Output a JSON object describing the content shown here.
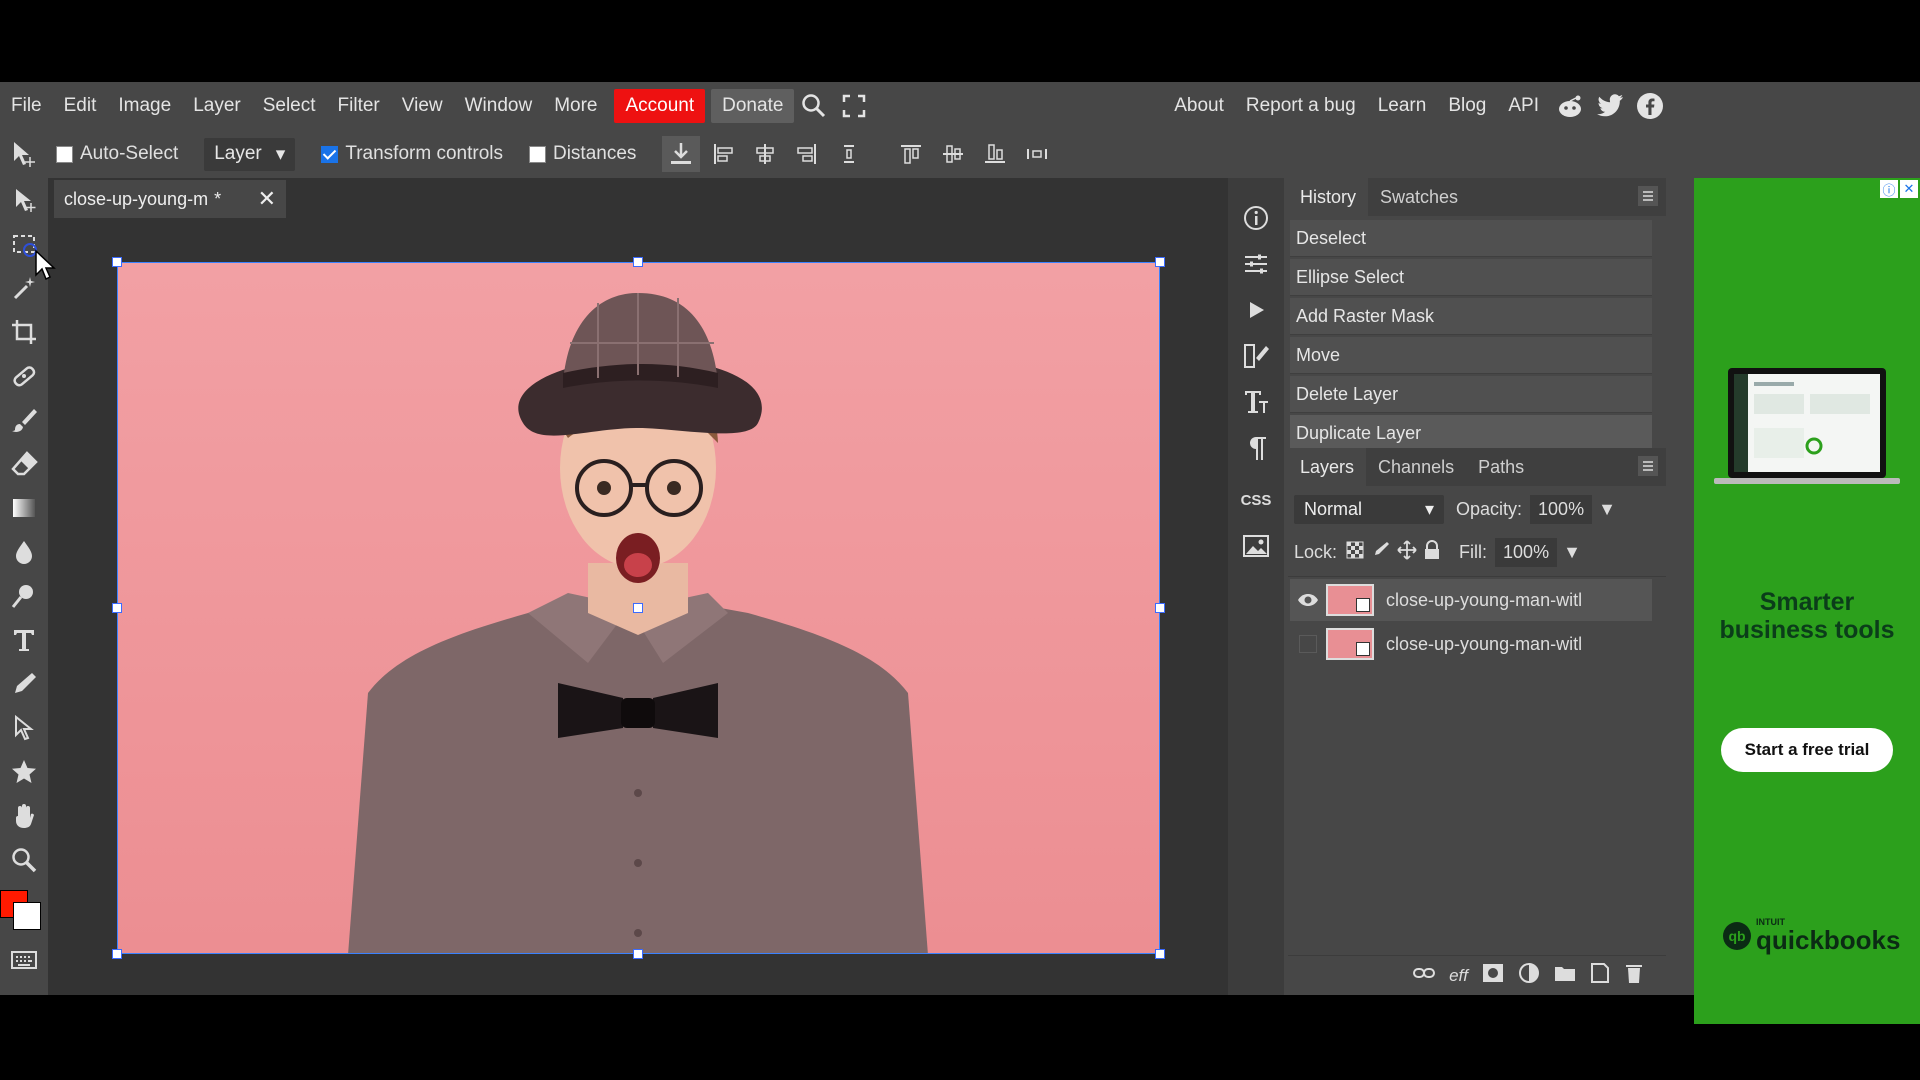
{
  "menubar": {
    "items": [
      "File",
      "Edit",
      "Image",
      "Layer",
      "Select",
      "Filter",
      "View",
      "Window",
      "More"
    ],
    "account": "Account",
    "donate": "Donate",
    "right": [
      "About",
      "Report a bug",
      "Learn",
      "Blog",
      "API"
    ]
  },
  "options": {
    "auto_select": "Auto-Select",
    "layer_select": "Layer",
    "transform_controls": "Transform controls",
    "distances": "Distances"
  },
  "document": {
    "tab_title": "close-up-young-m",
    "modified": "*"
  },
  "history_panel": {
    "tabs": [
      "History",
      "Swatches"
    ],
    "items": [
      "Deselect",
      "Ellipse Select",
      "Add Raster Mask",
      "Move",
      "Delete Layer",
      "Duplicate Layer"
    ]
  },
  "layers_panel": {
    "tabs": [
      "Layers",
      "Channels",
      "Paths"
    ],
    "blend_mode": "Normal",
    "opacity_label": "Opacity:",
    "opacity": "100%",
    "lock_label": "Lock:",
    "fill_label": "Fill:",
    "fill": "100%",
    "layers": [
      {
        "name": "close-up-young-man-witl",
        "visible": true
      },
      {
        "name": "close-up-young-man-witl",
        "visible": false
      }
    ]
  },
  "side_icons": {
    "css_label": "CSS"
  },
  "ad": {
    "headline_1": "Smarter",
    "headline_2": "business tools",
    "cta": "Start a free trial",
    "brand_small": "INTUIT",
    "brand": "quickbooks"
  },
  "colors": {
    "foreground": "#ff1a00",
    "background": "#ffffff",
    "accent": "#e11111",
    "ad_bg": "#2ca01c"
  }
}
